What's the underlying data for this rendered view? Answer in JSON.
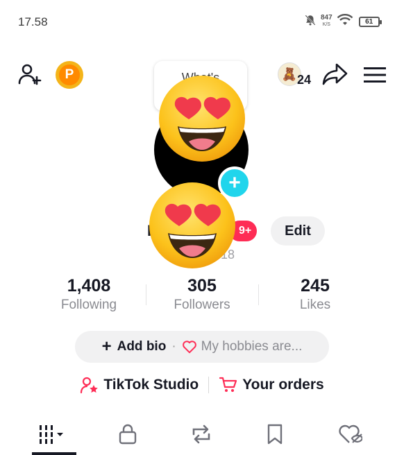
{
  "status_bar": {
    "time": "17.58",
    "net_speed_value": "847",
    "net_speed_unit": "K/S",
    "battery": "61"
  },
  "top_bar": {
    "coin_letter": "P",
    "bubble_text": "What's",
    "notification_count": "24"
  },
  "profile": {
    "name": "I",
    "badge": "9+",
    "username": "18",
    "edit_label": "Edit"
  },
  "stats": [
    {
      "value": "1,408",
      "label": "Following"
    },
    {
      "value": "305",
      "label": "Followers"
    },
    {
      "value": "245",
      "label": "Likes"
    }
  ],
  "bio": {
    "add_label": "Add bio",
    "separator": "·",
    "placeholder": "My hobbies are..."
  },
  "links": {
    "studio": "TikTok Studio",
    "orders": "Your orders"
  },
  "tabs": [
    "posts-grid",
    "private",
    "reposts",
    "saved",
    "liked"
  ],
  "colors": {
    "accent": "#fe2c55",
    "plus_blue": "#20d5ec",
    "coin": "#f4b41a",
    "text": "#161823",
    "muted": "#8a8b91",
    "pill_bg": "#f1f1f2"
  }
}
